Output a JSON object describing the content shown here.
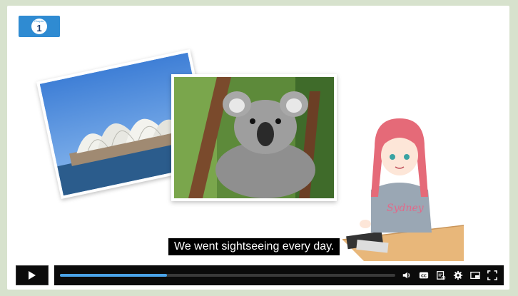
{
  "chapter_badge": {
    "number": "1"
  },
  "photos": {
    "opera_house": "opera-house-photo",
    "koala": "koala-photo"
  },
  "subtitle": {
    "text": "We went sightseeing every day."
  },
  "player": {
    "progress_fraction": 0.32,
    "accent_color": "#4aa3e8",
    "icons": [
      "play-icon",
      "volume-icon",
      "closed-captions-icon",
      "transcript-icon",
      "settings-icon",
      "picture-in-picture-icon",
      "fullscreen-icon"
    ]
  }
}
